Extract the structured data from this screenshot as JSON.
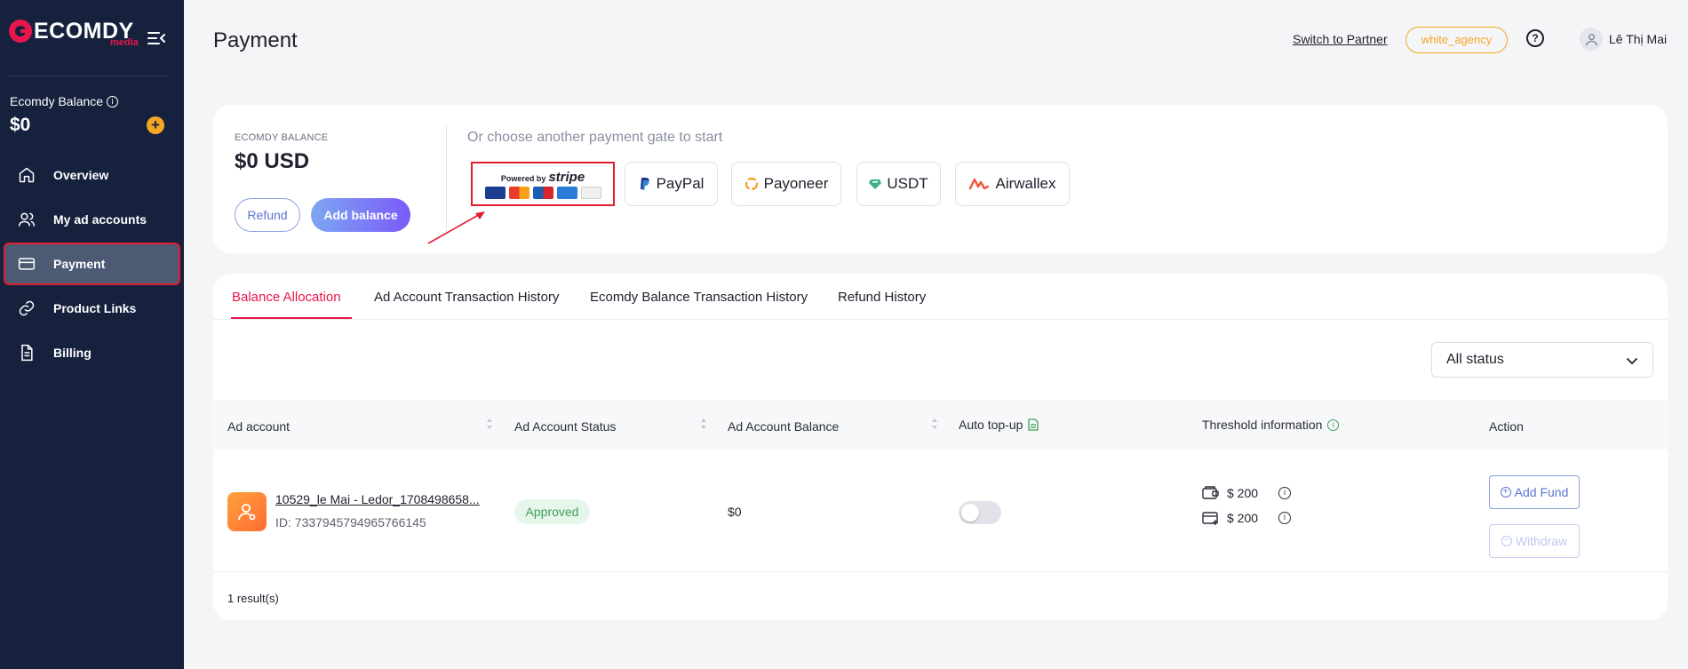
{
  "sidebar": {
    "logo_text": "ECOMDY",
    "logo_sub": "media",
    "balance_label": "Ecomdy Balance",
    "balance_value": "$0",
    "items": [
      {
        "label": "Overview",
        "icon": "home-icon"
      },
      {
        "label": "My ad accounts",
        "icon": "users-icon"
      },
      {
        "label": "Payment",
        "icon": "credit-card-icon",
        "active": true
      },
      {
        "label": "Product Links",
        "icon": "link-icon"
      },
      {
        "label": "Billing",
        "icon": "document-icon"
      }
    ]
  },
  "header": {
    "title": "Payment",
    "switch_label": "Switch to Partner",
    "agency_badge": "white_agency",
    "help_icon": "question-circle-icon",
    "user_name": "Lê Thị Mai"
  },
  "balance_card": {
    "label": "ECOMDY BALANCE",
    "value": "$0 USD",
    "refund_label": "Refund",
    "add_balance_label": "Add balance",
    "gate_prompt": "Or choose another payment gate to start",
    "stripe": {
      "powered_by": "Powered by",
      "brand": "stripe"
    },
    "gates": [
      {
        "label": "PayPal"
      },
      {
        "label": "Payoneer"
      },
      {
        "label": "USDT"
      },
      {
        "label": "Airwallex"
      }
    ]
  },
  "tabs": [
    {
      "label": "Balance Allocation",
      "active": true
    },
    {
      "label": "Ad Account Transaction History"
    },
    {
      "label": "Ecomdy Balance Transaction History"
    },
    {
      "label": "Refund History"
    }
  ],
  "filter": {
    "selected": "All status"
  },
  "table": {
    "columns": [
      "Ad account",
      "Ad Account Status",
      "Ad Account Balance",
      "Auto top-up",
      "Threshold information",
      "Action"
    ],
    "rows": [
      {
        "name": "10529_le Mai - Ledor_1708498658...",
        "id": "ID: 7337945794965766145",
        "status": "Approved",
        "balance": "$0",
        "auto_topup": false,
        "threshold_1": "$ 200",
        "threshold_2": "$ 200",
        "add_fund_label": "Add Fund",
        "withdraw_label": "Withdraw"
      }
    ]
  },
  "results_text": "1 result(s)",
  "colors": {
    "sidebar_bg": "#16213e",
    "brand_red": "#e8174b",
    "accent_orange": "#f5a623",
    "accent_blue": "#5b73d4",
    "approved_green": "#3f9e58"
  }
}
